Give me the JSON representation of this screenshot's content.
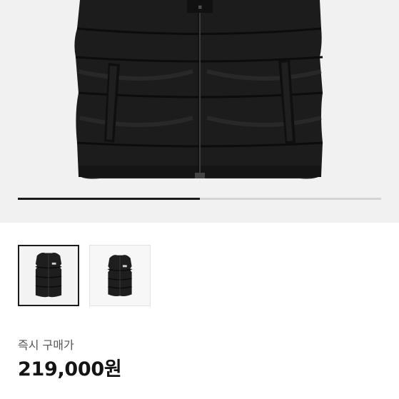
{
  "product": {
    "main_image": "black-padded-vest-photo",
    "gallery": {
      "progress": 0.5,
      "thumbnails": [
        {
          "image": "black-padded-vest-photo",
          "selected": true
        },
        {
          "image": "black-padded-vest-flat-photo",
          "selected": false
        }
      ]
    },
    "price_label": "즉시 구매가",
    "price": "219,000원"
  },
  "colors": {
    "hero_background": "#f1f1f1",
    "progress_fill": "#1b1b1b",
    "progress_track": "#d4d4d4",
    "price_text": "#141414"
  }
}
